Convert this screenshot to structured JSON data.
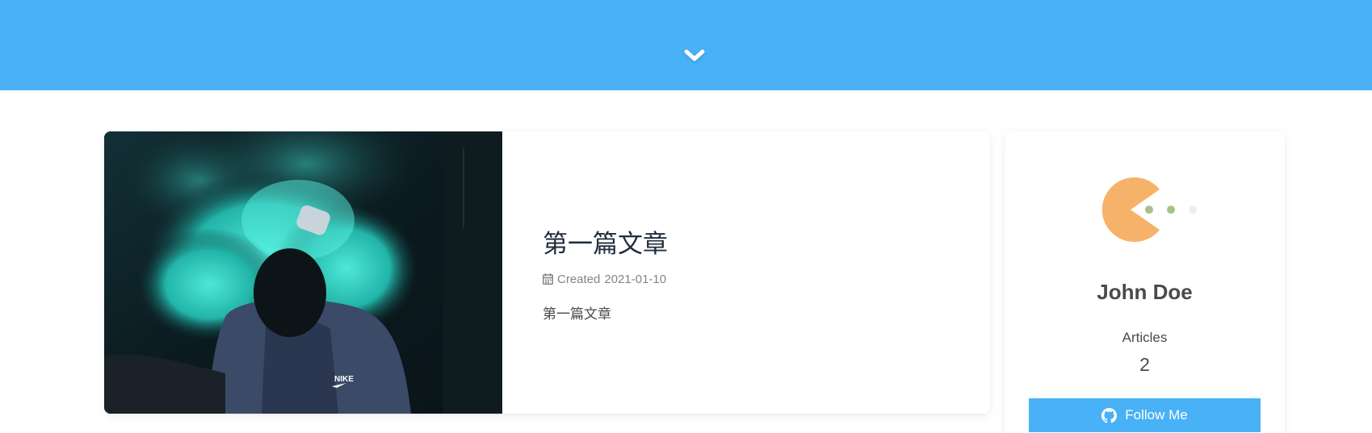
{
  "hero": {
    "color": "#49b1f5",
    "scroll_icon": "chevron-down-icon"
  },
  "post": {
    "title": "第一篇文章",
    "meta_icon": "calendar-icon",
    "meta_label": "Created",
    "date": "2021-01-10",
    "excerpt": "第一篇文章",
    "cover_description_icon": "cover-image"
  },
  "author": {
    "avatar_icon": "pacman-icon",
    "name": "John Doe",
    "stats": {
      "label": "Articles",
      "value": "2"
    },
    "follow_label": "Follow Me",
    "follow_icon": "github-icon"
  },
  "colors": {
    "accent": "#49b1f5",
    "avatar": "#f7b26a",
    "text": "#4c4948",
    "title": "#1f2d3d",
    "meta": "#858585"
  }
}
